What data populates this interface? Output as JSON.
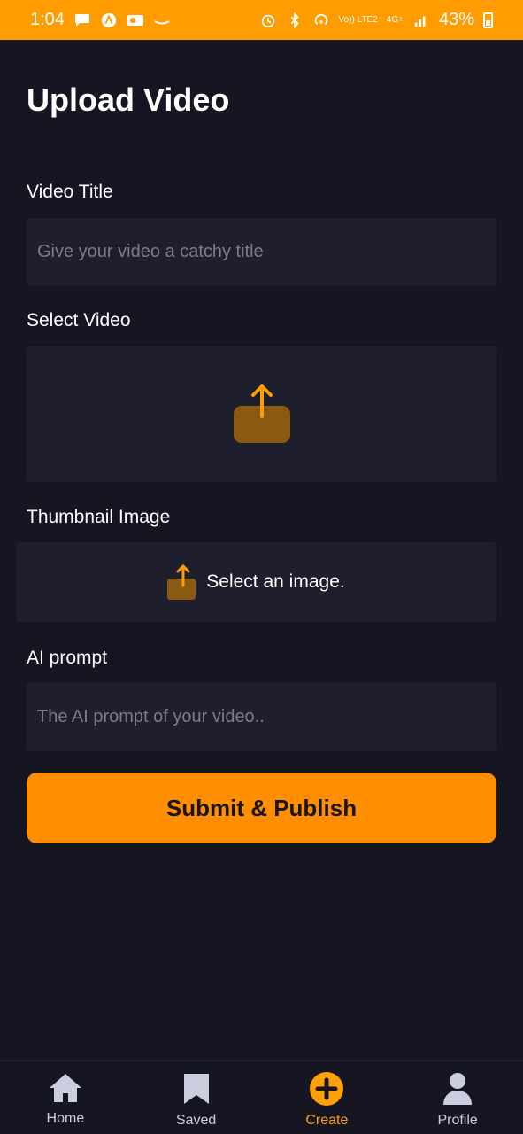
{
  "status_bar": {
    "time": "1:04",
    "network_top": "Vo)) LTE2",
    "network_gen": "4G+",
    "battery_text": "43%"
  },
  "page": {
    "title": "Upload Video"
  },
  "form": {
    "video_title_label": "Video Title",
    "video_title_placeholder": "Give your video a catchy title",
    "select_video_label": "Select Video",
    "thumbnail_label": "Thumbnail Image",
    "thumbnail_select_text": "Select an image.",
    "ai_prompt_label": "AI prompt",
    "ai_prompt_placeholder": "The AI prompt of your video..",
    "submit_label": "Submit & Publish"
  },
  "tabs": [
    {
      "label": "Home",
      "icon": "home-icon"
    },
    {
      "label": "Saved",
      "icon": "bookmark-icon"
    },
    {
      "label": "Create",
      "icon": "plus-circle-icon"
    },
    {
      "label": "Profile",
      "icon": "profile-icon"
    }
  ],
  "colors": {
    "status_bar": "#FF9C01",
    "background": "#161622",
    "field_bg": "#1E1E2D",
    "accent": "#FF8E01",
    "active_tab": "#FFA001",
    "inactive_tab": "#CDCDE0"
  }
}
